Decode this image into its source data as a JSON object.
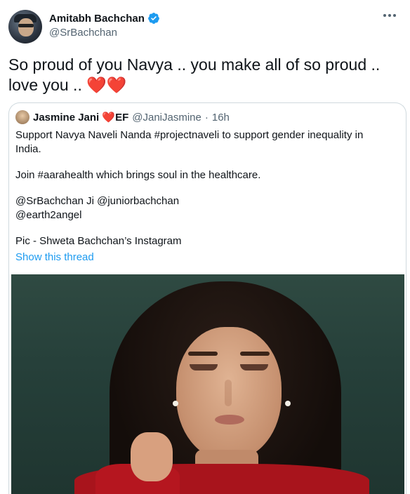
{
  "tweet": {
    "display_name": "Amitabh Bachchan",
    "handle": "@SrBachchan",
    "text": "So proud of you Navya  .. you make all of so proud .. love you .. ",
    "hearts": "❤️❤️"
  },
  "quote": {
    "display_name": "Jasmine Jani",
    "name_suffix_emoji": "❤️",
    "name_suffix": "EF",
    "handle": "@JaniJasmine",
    "separator": "·",
    "time": "16h",
    "lines": [
      "Support Navya Naveli Nanda #projectnaveli to support gender inequality in India.",
      "Join #aarahealth which brings soul in the healthcare.",
      "@SrBachchan Ji @juniorbachchan",
      "@earth2angel",
      "Pic - Shweta Bachchan’s  Instagram"
    ],
    "show_thread": "Show this thread"
  },
  "colors": {
    "accent": "#1d9bf0",
    "heart": "#e0245e",
    "secondary_text": "#536471",
    "border": "#cfd9de"
  },
  "icons": {
    "verified": "verified-badge-icon",
    "more": "more-options-icon"
  }
}
